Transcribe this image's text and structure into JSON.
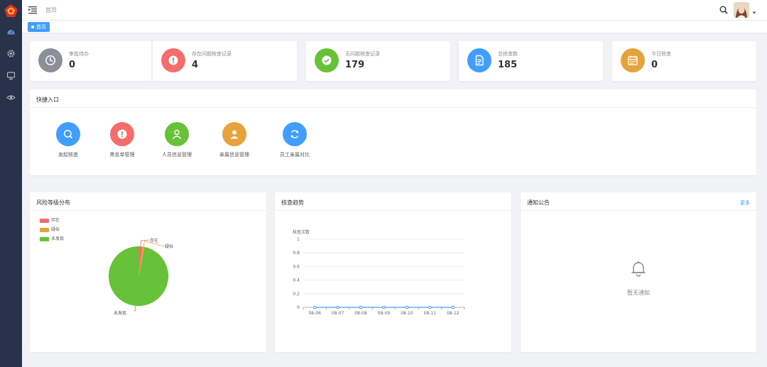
{
  "header": {
    "breadcrumb": "首页",
    "active_tab": "首页"
  },
  "stats": [
    {
      "label": "审批待办",
      "value": "0",
      "icon": "clock-icon",
      "color": "#8b8f99"
    },
    {
      "label": "存在问题核查记录",
      "value": "4",
      "icon": "alert-icon",
      "color": "#f56c6c"
    },
    {
      "label": "无问题核查记录",
      "value": "179",
      "icon": "check-icon",
      "color": "#67c23a"
    },
    {
      "label": "总核查数",
      "value": "185",
      "icon": "document-icon",
      "color": "#409eff"
    },
    {
      "label": "今日核查",
      "value": "0",
      "icon": "calendar-icon",
      "color": "#e6a23c"
    }
  ],
  "quick_access": {
    "title": "快捷入口",
    "items": [
      {
        "label": "发起核查",
        "icon": "search-icon",
        "color": "#409eff"
      },
      {
        "label": "黑名单管理",
        "icon": "alert-icon",
        "color": "#f56c6c"
      },
      {
        "label": "人员信息管理",
        "icon": "user-icon",
        "color": "#67c23a"
      },
      {
        "label": "亲属信息管理",
        "icon": "user-filled-icon",
        "color": "#e6a23c"
      },
      {
        "label": "员工亲属对比",
        "icon": "refresh-icon",
        "color": "#409eff"
      }
    ]
  },
  "risk_panel": {
    "title": "风险等级分布"
  },
  "trend_panel": {
    "title": "核查趋势"
  },
  "notice_panel": {
    "title": "通知公告",
    "more": "更多",
    "empty_text": "暂无通知"
  },
  "chart_data": [
    {
      "type": "pie",
      "title": "风险等级分布",
      "categories": [
        "存在",
        "疑似",
        "未发现"
      ],
      "values": [
        4,
        2,
        179
      ],
      "colors": [
        "#f56c6c",
        "#e6a23c",
        "#67c23a"
      ],
      "legend_position": "top-left"
    },
    {
      "type": "line",
      "title": "核查趋势",
      "ylabel": "核查次数",
      "x": [
        "08-06",
        "08-07",
        "08-08",
        "08-09",
        "08-10",
        "08-11",
        "08-12"
      ],
      "series": [
        {
          "values": [
            0,
            0,
            0,
            0,
            0,
            0,
            0
          ]
        }
      ],
      "ylim": [
        0,
        1
      ],
      "yticks": [
        "0",
        "0.2",
        "0.4",
        "0.6",
        "0.8",
        "1"
      ],
      "color": "#409eff",
      "grid": true
    }
  ]
}
